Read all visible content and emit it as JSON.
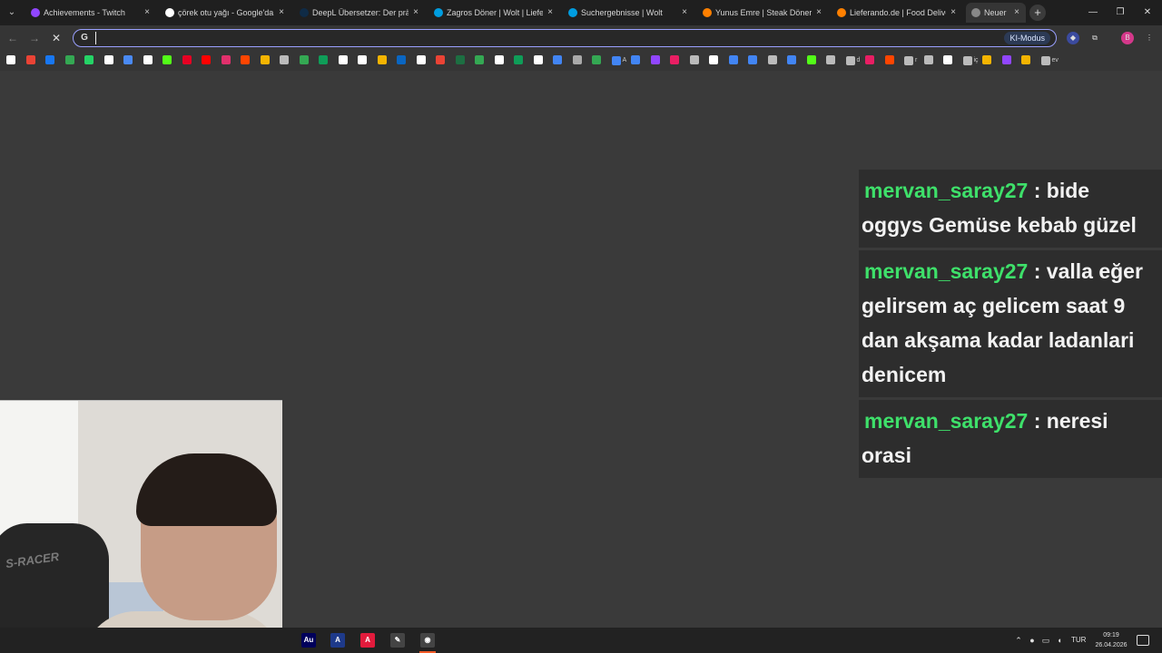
{
  "tabs": [
    {
      "title": "Achievements - Twitch",
      "favicon_color": "#9146ff",
      "icon": "twitch-icon"
    },
    {
      "title": "çörek otu yağı - Google'da Ara",
      "favicon_color": "#ffffff",
      "icon": "google-icon"
    },
    {
      "title": "DeepL Übersetzer: Der präzi",
      "favicon_color": "#0f2b46",
      "icon": "deepl-icon"
    },
    {
      "title": "Zagros Döner | Wolt | Lieferu",
      "favicon_color": "#009de0",
      "icon": "wolt-icon"
    },
    {
      "title": "Suchergebnisse | Wolt",
      "favicon_color": "#009de0",
      "icon": "wolt-icon"
    },
    {
      "title": "Yunus Emre | Steak Döner M",
      "favicon_color": "#ff8000",
      "icon": "lieferando-icon"
    },
    {
      "title": "Lieferando.de | Food Deliver",
      "favicon_color": "#ff8000",
      "icon": "lieferando-icon"
    },
    {
      "title": "Neuer",
      "favicon_color": "#888888",
      "icon": "new-tab-icon",
      "active": true
    }
  ],
  "tab_close_glyph": "×",
  "newtab_glyph": "+",
  "window": {
    "minimize": "—",
    "restore": "❐",
    "close": "✕"
  },
  "nav": {
    "back": "←",
    "forward": "→",
    "stop": "✕"
  },
  "omnibox": {
    "value": "",
    "g_label": "G",
    "ki_label": "KI-Modus"
  },
  "bookmarks": [
    {
      "label": "",
      "color": "#ffffff",
      "icon": "google-icon"
    },
    {
      "label": "",
      "color": "#ea4335",
      "icon": "gmail-icon"
    },
    {
      "label": "",
      "color": "#1877f2",
      "icon": "facebook-icon"
    },
    {
      "label": "",
      "color": "#34a853",
      "icon": "drive-icon"
    },
    {
      "label": "",
      "color": "#25d366",
      "icon": "whatsapp-icon"
    },
    {
      "label": "",
      "color": "#ffffff",
      "icon": "x-icon"
    },
    {
      "label": "",
      "color": "#4a8af4",
      "icon": "translate-icon"
    },
    {
      "label": "",
      "color": "#ffffff",
      "icon": "arrow-icon"
    },
    {
      "label": "",
      "color": "#53fc18",
      "icon": "kick-icon"
    },
    {
      "label": "",
      "color": "#e60023",
      "icon": "pinterest-icon"
    },
    {
      "label": "",
      "color": "#ff0000",
      "icon": "youtube-icon"
    },
    {
      "label": "",
      "color": "#e1306c",
      "icon": "instagram-icon"
    },
    {
      "label": "",
      "color": "#ff4500",
      "icon": "reddit-icon"
    },
    {
      "label": "",
      "color": "#f4b400",
      "icon": "keep-icon"
    },
    {
      "label": "",
      "color": "#bbbbbb",
      "icon": "folder-icon"
    },
    {
      "label": "",
      "color": "#34a853",
      "icon": "drive-icon"
    },
    {
      "label": "",
      "color": "#0f9d58",
      "icon": "photos-icon"
    },
    {
      "label": "",
      "color": "#ffffff",
      "icon": "google-icon"
    },
    {
      "label": "",
      "color": "#ffffff",
      "icon": "wikipedia-icon"
    },
    {
      "label": "",
      "color": "#f4b400",
      "icon": "bookmark-icon"
    },
    {
      "label": "",
      "color": "#0a66c2",
      "icon": "linkedin-icon"
    },
    {
      "label": "",
      "color": "#ffffff",
      "icon": "info-icon"
    },
    {
      "label": "",
      "color": "#ea4335",
      "icon": "red-icon"
    },
    {
      "label": "",
      "color": "#1d6f42",
      "icon": "excel-icon"
    },
    {
      "label": "",
      "color": "#34a853",
      "icon": "maps-icon"
    },
    {
      "label": "",
      "color": "#ffffff",
      "icon": "sheets-icon"
    },
    {
      "label": "",
      "color": "#0f9d58",
      "icon": "drive-icon"
    },
    {
      "label": "",
      "color": "#ffffff",
      "icon": "edit-icon"
    },
    {
      "label": "",
      "color": "#4285f4",
      "icon": "app-icon"
    },
    {
      "label": "",
      "color": "#aaaaaa",
      "icon": "app-icon"
    },
    {
      "label": "",
      "color": "#34a853",
      "icon": "app-icon"
    },
    {
      "label": "A",
      "color": "#4285f4",
      "icon": "docs-icon"
    },
    {
      "label": "",
      "color": "#4285f4",
      "icon": "docs-icon"
    },
    {
      "label": "",
      "color": "#9146ff",
      "icon": "twitch-icon"
    },
    {
      "label": "",
      "color": "#e91e63",
      "icon": "app-icon"
    },
    {
      "label": "",
      "color": "#bbbbbb",
      "icon": "folder-icon"
    },
    {
      "label": "",
      "color": "#ffffff",
      "icon": "app-icon"
    },
    {
      "label": "",
      "color": "#4285f4",
      "icon": "gemini-icon"
    },
    {
      "label": "",
      "color": "#4285f4",
      "icon": "docs-icon"
    },
    {
      "label": "",
      "color": "#bbbbbb",
      "icon": "folder-icon"
    },
    {
      "label": "",
      "color": "#4285f4",
      "icon": "docs-icon"
    },
    {
      "label": "",
      "color": "#53fc18",
      "icon": "kick-icon"
    },
    {
      "label": "",
      "color": "#bbbbbb",
      "icon": "folder-icon"
    },
    {
      "label": "d",
      "color": "#bbbbbb",
      "icon": "folder-icon"
    },
    {
      "label": "",
      "color": "#e91e63",
      "icon": "app-icon"
    },
    {
      "label": "",
      "color": "#ff4500",
      "icon": "app-icon"
    },
    {
      "label": "r",
      "color": "#bbbbbb",
      "icon": "folder-icon"
    },
    {
      "label": "",
      "color": "#bbbbbb",
      "icon": "folder-icon"
    },
    {
      "label": "",
      "color": "#ffffff",
      "icon": "app-icon"
    },
    {
      "label": "iç",
      "color": "#bbbbbb",
      "icon": "folder-icon"
    },
    {
      "label": "",
      "color": "#f4b400",
      "icon": "app-icon"
    },
    {
      "label": "",
      "color": "#9146ff",
      "icon": "app-icon"
    },
    {
      "label": "",
      "color": "#f4b400",
      "icon": "app-icon"
    },
    {
      "label": "ev",
      "color": "#bbbbbb",
      "icon": "folder-icon"
    }
  ],
  "chat": [
    {
      "user": "mervan_saray27",
      "sep": ":",
      "text": "bide oggys Gemüse kebab güzel"
    },
    {
      "user": "mervan_saray27",
      "sep": ":",
      "text": "valla eğer gelirsem aç gelicem saat 9 dan akşama kadar ladanlari denicem"
    },
    {
      "user": "mervan_saray27",
      "sep": ":",
      "text": "neresi orasi"
    }
  ],
  "webcam": {
    "chair_label": "S-RACER"
  },
  "taskbar": {
    "apps": [
      {
        "label": "Au",
        "color": "#00005b",
        "icon": "audition-icon"
      },
      {
        "label": "A",
        "color": "#1e3a8a",
        "icon": "affinity-icon"
      },
      {
        "label": "A",
        "color": "#e21b3c",
        "icon": "acrobat-icon"
      },
      {
        "label": "✎",
        "color": "#444444",
        "icon": "pencil-app-icon"
      },
      {
        "label": "◉",
        "color": "#444444",
        "icon": "obs-icon"
      }
    ],
    "lang": "TUR",
    "time": "09:19",
    "date": "26.04.2026"
  },
  "colors": {
    "accent": "#9aa0ff",
    "chat_user": "#3ee06a",
    "chat_bg": "#2d2d2d"
  }
}
